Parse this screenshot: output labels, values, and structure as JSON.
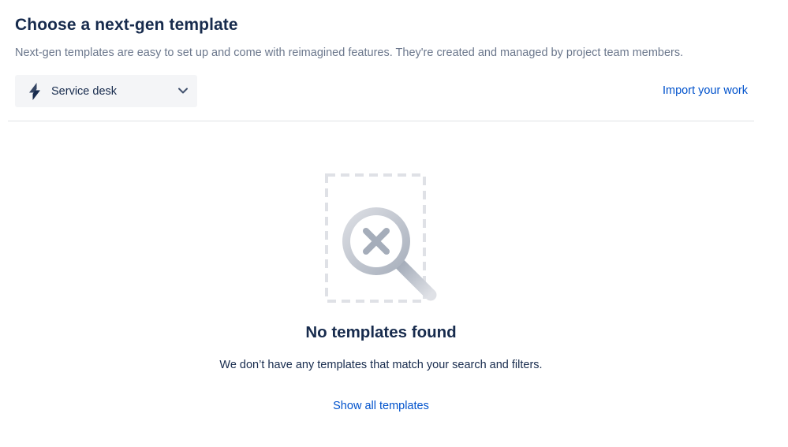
{
  "header": {
    "title": "Choose a next-gen template",
    "subtitle": "Next-gen templates are easy to set up and come with reimagined features. They're created and managed by project team members."
  },
  "product_select": {
    "icon": "bolt-icon",
    "selected": "Service desk"
  },
  "actions": {
    "import_label": "Import your work"
  },
  "empty_state": {
    "icon": "search-no-results-icon",
    "title": "No templates found",
    "description": "We don’t have any templates that match your search and filters.",
    "show_all_label": "Show all templates"
  },
  "colors": {
    "text_primary": "#172b4d",
    "text_subtle": "#6b778c",
    "link": "#0052cc",
    "select_bg": "#f4f5f7",
    "divider": "#dfe1e6"
  }
}
